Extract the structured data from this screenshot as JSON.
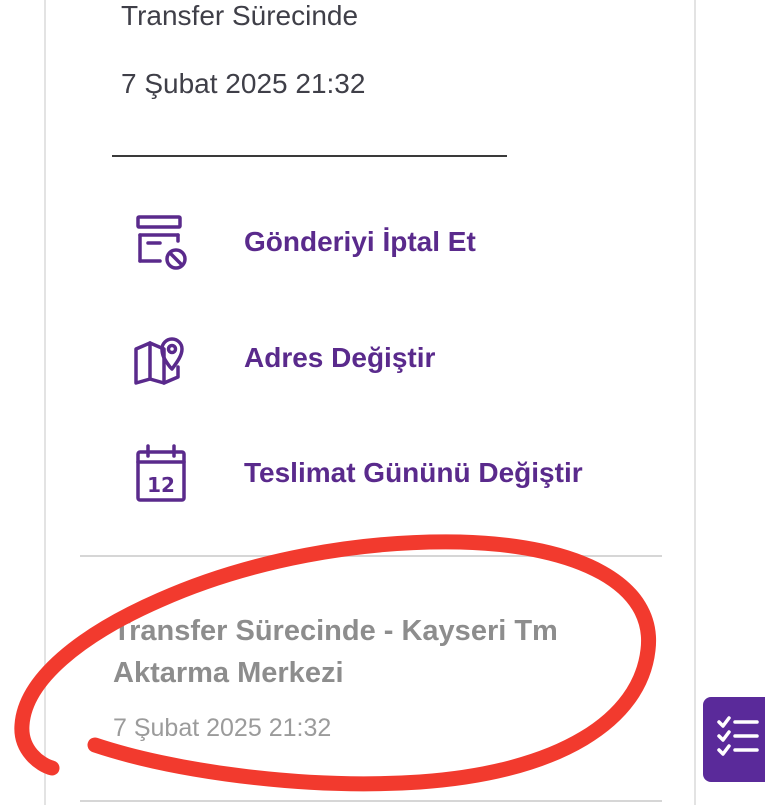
{
  "shipment": {
    "status": "Transfer Sürecinde",
    "date": "7 Şubat 2025 21:32"
  },
  "actions": [
    {
      "label": "Gönderiyi İptal Et",
      "icon": "cancel-shipment-icon"
    },
    {
      "label": "Adres Değiştir",
      "icon": "map-pin-icon"
    },
    {
      "label": "Teslimat Gününü Değiştir",
      "icon": "calendar-icon"
    }
  ],
  "calendar_icon_day": "12",
  "history": [
    {
      "title": "Transfer Sürecinde - Kayseri Tm Aktarma Merkezi",
      "date": "7 Şubat 2025 21:32"
    }
  ],
  "fab": {
    "icon": "checklist-icon"
  },
  "colors": {
    "accent": "#5a2a8c",
    "fab": "#5a2a9a",
    "annotation": "#f23a2e",
    "text_dark": "#3f3f48",
    "text_muted": "#8d8d8d"
  }
}
